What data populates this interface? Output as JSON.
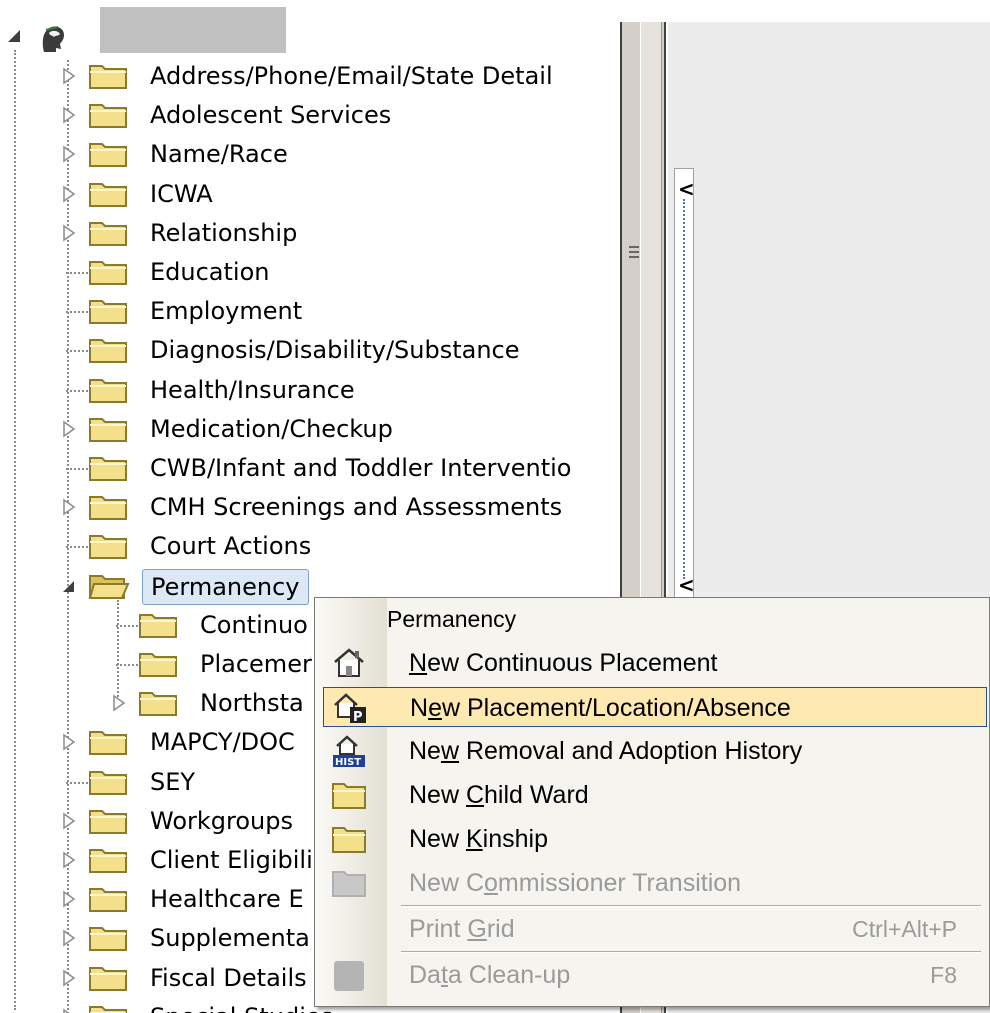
{
  "tree": {
    "root": {
      "icon": "person-head-icon",
      "expander": "expanded-arrow"
    },
    "items": [
      {
        "label": "Address/Phone/Email/State Detail",
        "expander": "collapsed",
        "level": 1
      },
      {
        "label": "Adolescent Services",
        "expander": "collapsed",
        "level": 1
      },
      {
        "label": "Name/Race",
        "expander": "collapsed",
        "level": 1
      },
      {
        "label": "ICWA",
        "expander": "collapsed",
        "level": 1
      },
      {
        "label": "Relationship",
        "expander": "collapsed",
        "level": 1
      },
      {
        "label": "Education",
        "expander": "none",
        "level": 1
      },
      {
        "label": "Employment",
        "expander": "none",
        "level": 1
      },
      {
        "label": "Diagnosis/Disability/Substance",
        "expander": "none",
        "level": 1
      },
      {
        "label": "Health/Insurance",
        "expander": "none",
        "level": 1
      },
      {
        "label": "Medication/Checkup",
        "expander": "collapsed",
        "level": 1
      },
      {
        "label": "CWB/Infant and Toddler Interventio",
        "expander": "none",
        "level": 1
      },
      {
        "label": "CMH Screenings and Assessments",
        "expander": "collapsed",
        "level": 1
      },
      {
        "label": "Court Actions",
        "expander": "none",
        "level": 1
      },
      {
        "label": "Permanency",
        "expander": "expanded",
        "level": 1,
        "selected": true,
        "open": true
      },
      {
        "label": "Continuo",
        "expander": "none",
        "level": 2
      },
      {
        "label": "Placemer",
        "expander": "none",
        "level": 2
      },
      {
        "label": "Northsta",
        "expander": "collapsed",
        "level": 2
      },
      {
        "label": "MAPCY/DOC",
        "expander": "collapsed",
        "level": 1
      },
      {
        "label": "SEY",
        "expander": "none",
        "level": 1
      },
      {
        "label": "Workgroups",
        "expander": "collapsed",
        "level": 1
      },
      {
        "label": "Client Eligibili",
        "expander": "collapsed",
        "level": 1
      },
      {
        "label": "Healthcare E",
        "expander": "collapsed",
        "level": 1
      },
      {
        "label": "Supplementa",
        "expander": "collapsed",
        "level": 1
      },
      {
        "label": "Fiscal Details",
        "expander": "collapsed",
        "level": 1
      },
      {
        "label": "Special Studies",
        "expander": "collapsed",
        "level": 1
      }
    ]
  },
  "splitter": {
    "icon": "grip-icon"
  },
  "right_panel": {
    "chevron_top": "<",
    "chevron_bottom": "<"
  },
  "context_menu": {
    "title": "Permanency",
    "items": [
      {
        "pre": "",
        "key": "N",
        "post": "ew Continuous Placement",
        "icon": "house-icon",
        "disabled": false,
        "highlighted": false
      },
      {
        "pre": "N",
        "key": "e",
        "post": "w Placement/Location/Absence",
        "icon": "house-p-icon",
        "disabled": false,
        "highlighted": true
      },
      {
        "pre": "Ne",
        "key": "w",
        "post": " Removal and Adoption History",
        "icon": "house-hist-icon",
        "disabled": false,
        "highlighted": false
      },
      {
        "pre": "New ",
        "key": "C",
        "post": "hild Ward",
        "icon": "folder-icon",
        "disabled": false,
        "highlighted": false
      },
      {
        "pre": "New ",
        "key": "K",
        "post": "inship",
        "icon": "folder-icon",
        "disabled": false,
        "highlighted": false
      },
      {
        "pre": "New C",
        "key": "o",
        "post": "mmissioner Transition",
        "icon": "folder-disabled-icon",
        "disabled": true,
        "highlighted": false
      },
      {
        "pre": "Print ",
        "key": "G",
        "post": "rid",
        "shortcut": "Ctrl+Alt+P",
        "icon": "",
        "disabled": true,
        "highlighted": false,
        "separator_before": true
      },
      {
        "pre": "Da",
        "key": "t",
        "post": "a Clean-up",
        "shortcut": "F8",
        "icon": "square-disabled-icon",
        "disabled": true,
        "highlighted": false,
        "separator_before": true
      }
    ]
  },
  "colors": {
    "folder": "#f4e08a",
    "folder_edge": "#8a7a2c",
    "highlight": "#ffe9b3",
    "highlight_border": "#2b4f96",
    "disabled_text": "#9a9a9a"
  }
}
